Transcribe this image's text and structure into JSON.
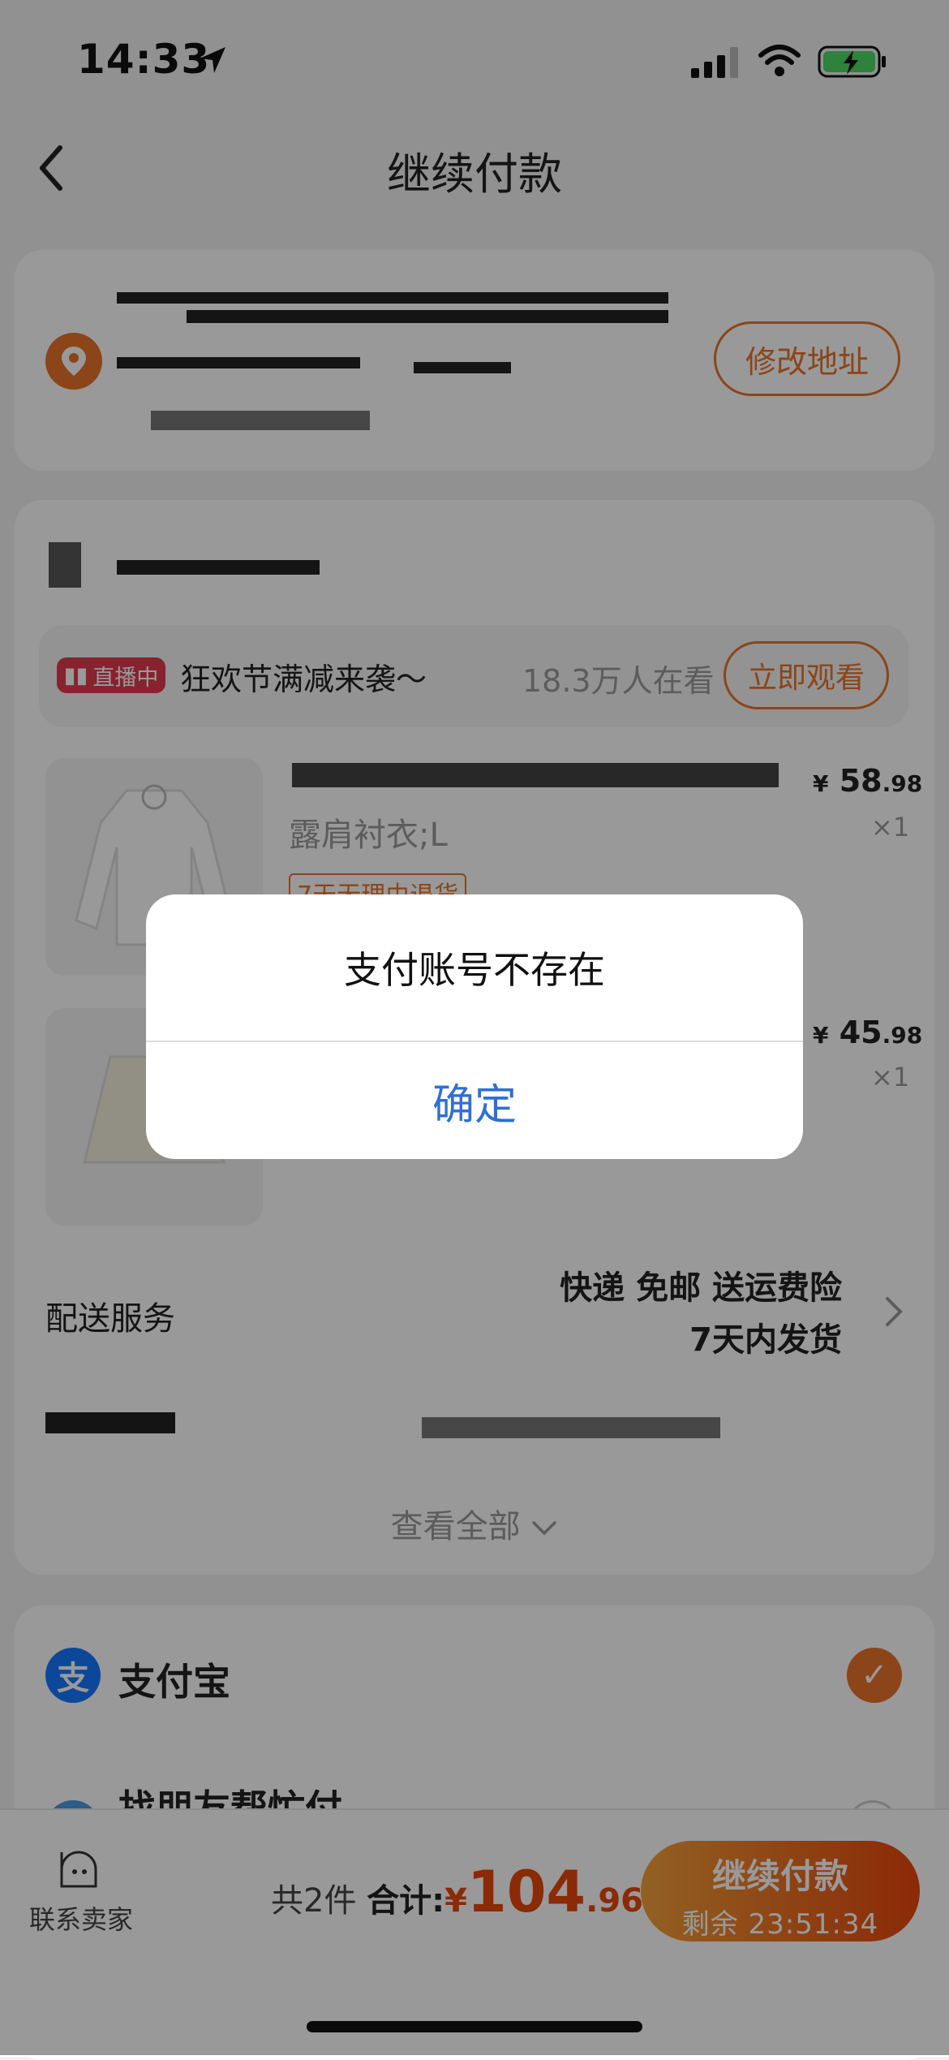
{
  "status_bar": {
    "time": "14:33"
  },
  "nav": {
    "title": "继续付款"
  },
  "address": {
    "edit_label": "修改地址"
  },
  "live": {
    "badge": "直播中",
    "promo": "狂欢节满减来袭～",
    "viewers": "18.3万人在看",
    "watch_label": "立即观看"
  },
  "items": [
    {
      "spec": "露肩衬衣;L",
      "currency": "¥",
      "price_int": "58",
      "price_dec": ".98",
      "qty": "×1",
      "tag": "7天无理由退货"
    },
    {
      "currency": "¥",
      "price_int": "45",
      "price_dec": ".98",
      "qty": "×1"
    }
  ],
  "shipping": {
    "label": "配送服务",
    "line1": "快递 免邮 送运费险",
    "line2": "7天内发货"
  },
  "view_all": "查看全部",
  "payment": {
    "alipay": "支付宝",
    "friend_pay": "找朋友帮忙付"
  },
  "bottom": {
    "contact": "联系卖家",
    "count": "共2件",
    "total_label": "合计:",
    "currency": "¥",
    "total_int": "104",
    "total_dec": ".96",
    "pay_label": "继续付款",
    "remaining": "剩余 23:51:34"
  },
  "dialog": {
    "message": "支付账号不存在",
    "confirm": "确定"
  },
  "colors": {
    "accent": "#e8732a",
    "price": "#e8460c",
    "link": "#2f6fd6",
    "alipay": "#1677ff"
  }
}
